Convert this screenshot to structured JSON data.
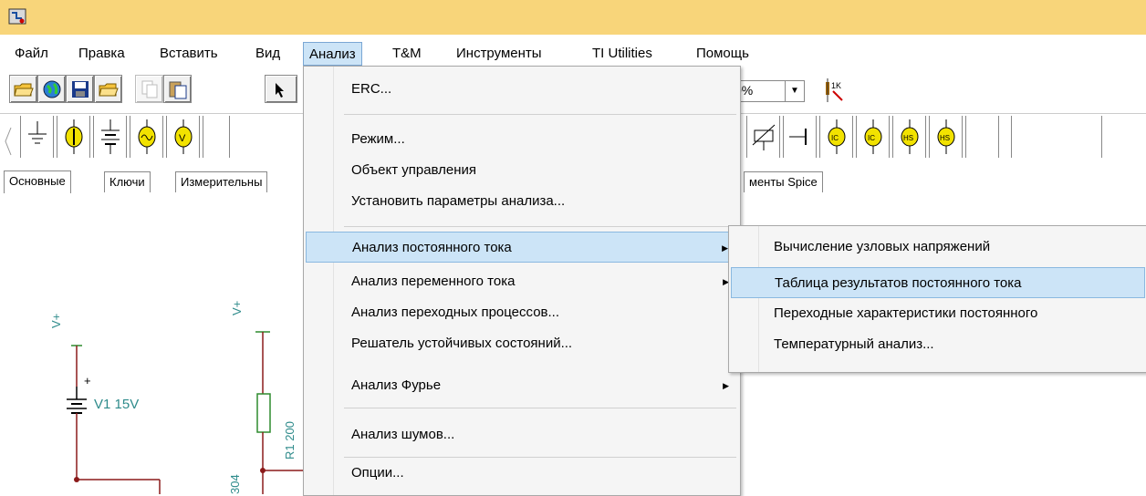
{
  "menubar": {
    "items": [
      "Файл",
      "Правка",
      "Вставить",
      "Вид",
      "Анализ",
      "T&M",
      "Инструменты",
      "TI Utilities",
      "Помощь"
    ]
  },
  "toolbar": {
    "zoom_value": "0%",
    "zoom_dropdown_arrow": "▼"
  },
  "component_tabs": [
    "Основные",
    "Ключи",
    "Измерительны",
    "менты Spice"
  ],
  "analysis_menu": {
    "items": [
      {
        "label": "ERC..."
      },
      {
        "label": "Режим..."
      },
      {
        "label": "Объект управления"
      },
      {
        "label": "Установить параметры анализа..."
      },
      {
        "label": "Анализ постоянного тока",
        "arrow": "▶"
      },
      {
        "label": "Анализ переменного тока",
        "arrow": "▶"
      },
      {
        "label": "Анализ переходных процессов..."
      },
      {
        "label": "Решатель устойчивых состояний..."
      },
      {
        "label": "Анализ Фурье",
        "arrow": "▶"
      },
      {
        "label": "Анализ шумов..."
      },
      {
        "label": "Опции..."
      }
    ]
  },
  "dc_submenu": {
    "items": [
      {
        "label": "Вычисление узловых напряжений"
      },
      {
        "label": "Таблица результатов постоянного тока"
      },
      {
        "label": "Переходные характеристики постоянного"
      },
      {
        "label": "Температурный анализ..."
      }
    ]
  },
  "schematic": {
    "source_label": "V1 15V",
    "vplus_1": "V+",
    "vplus_2": "V+",
    "plus_sign": "+",
    "resistor_label": "R1 200",
    "side_label": "304"
  },
  "colors": {
    "titlebar": "#f8d57a",
    "highlight": "#cce4f7",
    "wire": "#8b1a1a",
    "component": "#2e8b2e",
    "label": "#2e8b8b"
  }
}
